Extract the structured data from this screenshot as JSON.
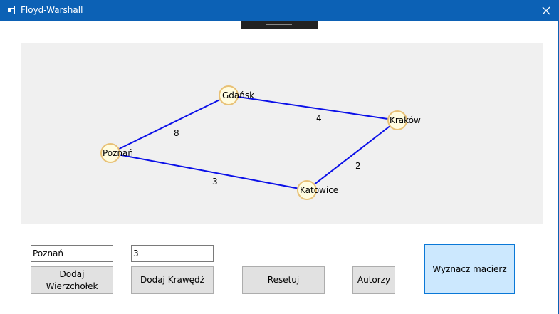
{
  "window": {
    "title": "Floyd-Warshall",
    "close_icon": "close-icon",
    "app_icon": "window-icon"
  },
  "graph": {
    "edge_color": "#0b10e8",
    "node_fill": "#fffce0",
    "node_stroke": "#e8c176",
    "nodes": [
      {
        "id": "poznan",
        "label": "Poznań"
      },
      {
        "id": "gdansk",
        "label": "Gdańsk"
      },
      {
        "id": "krakow",
        "label": "Kraków"
      },
      {
        "id": "katowice",
        "label": "Katowice"
      }
    ],
    "edges": [
      {
        "from": "poznan",
        "to": "gdansk",
        "weight": "8"
      },
      {
        "from": "gdansk",
        "to": "krakow",
        "weight": "4"
      },
      {
        "from": "krakow",
        "to": "katowice",
        "weight": "2"
      },
      {
        "from": "poznan",
        "to": "katowice",
        "weight": "3"
      }
    ]
  },
  "controls": {
    "vertex_input_value": "Poznań",
    "edge_input_value": "3",
    "add_vertex_label": "Dodaj\nWierzchołek",
    "add_edge_label": "Dodaj Krawędź",
    "reset_label": "Resetuj",
    "authors_label": "Autorzy",
    "compute_label": "Wyznacz macierz",
    "compute_button_color": "#cce8fe"
  }
}
